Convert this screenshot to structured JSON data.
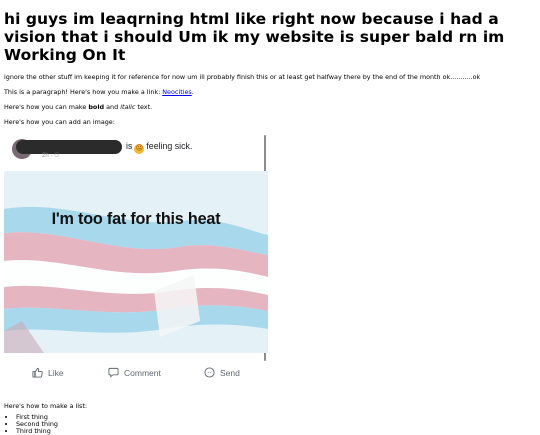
{
  "heading": "hi guys im leaqrning html like right now because i had a vision that i should Um ik my website is super bald rn im Working On It",
  "intro": "ignore the other stuff im keeping it for reference for now um ill probably finish this or at least get halfway there by the end of the month ok...........ok",
  "link_para": {
    "prefix": "This is a paragraph! Here's how you make a link: ",
    "link_text": "Neocities",
    "suffix": "."
  },
  "bold_para": {
    "prefix": "Here's how you can make ",
    "bold_text": "bold",
    "middle": " and ",
    "italic_text": "italic",
    "suffix": " text."
  },
  "image_para": "Here's how you can add an image:",
  "post": {
    "status_prefix": "is",
    "status_suffix": "feeling sick.",
    "time": "2h · ",
    "caption": "I'm too fat for this heat",
    "actions": {
      "like": "Like",
      "comment": "Comment",
      "send": "Send"
    },
    "icons": [
      "like-icon",
      "comment-icon",
      "send-icon",
      "sick-emoji-icon",
      "friends-icon"
    ]
  },
  "list_intro": "Here's how to make a list:",
  "list_items": [
    "First thing",
    "Second thing",
    "Third thing"
  ],
  "colors": {
    "link": "#0000ee",
    "flag_blue": "#5bcefa",
    "flag_pink": "#f5a9b8",
    "text_gray": "#606770"
  }
}
